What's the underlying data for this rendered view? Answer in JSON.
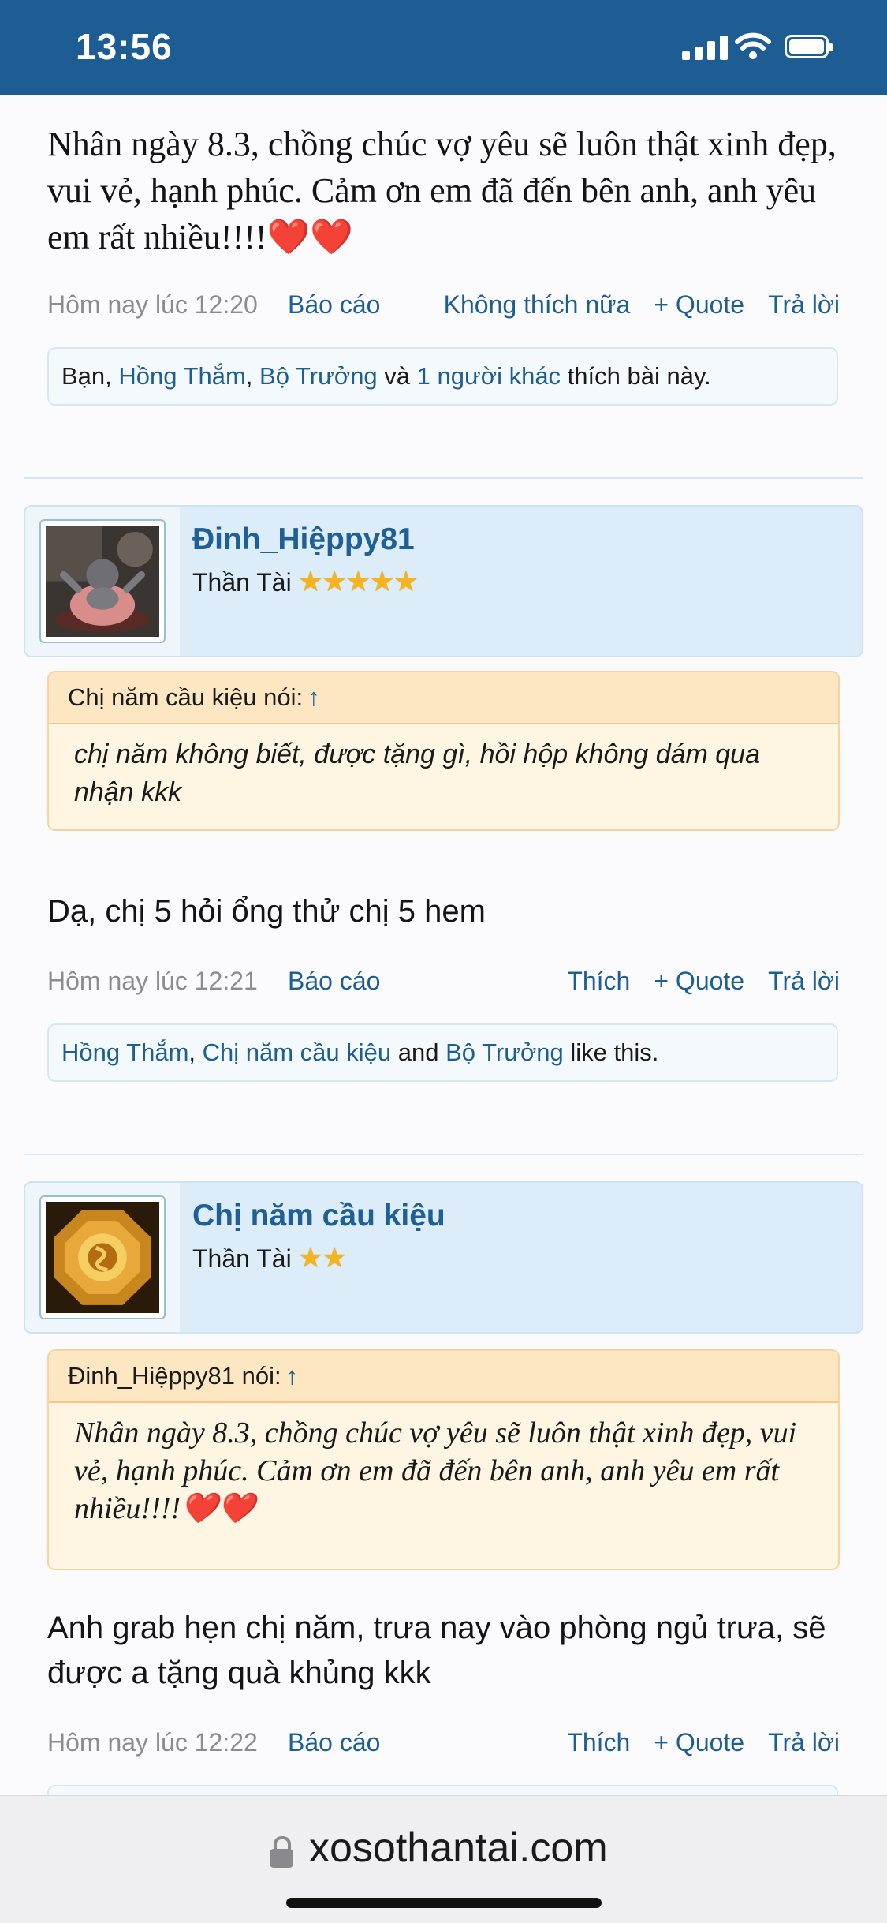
{
  "status_bar": {
    "time": "13:56"
  },
  "posts": [
    {
      "message": "Nhân ngày 8.3, chồng chúc vợ yêu sẽ luôn thật xinh đẹp, vui vẻ, hạnh phúc. Cảm ơn em đã đến bên anh, anh yêu em rất nhiều!!!!❤️❤️",
      "date": "Hôm nay lúc 12:20",
      "report": "Báo cáo",
      "like_action": "Không thích nữa",
      "quote_action": "+ Quote",
      "reply_action": "Trả lời",
      "likes": {
        "prefix": "Bạn, ",
        "user1": "Hồng Thắm",
        "sep1": ", ",
        "user2": "Bộ Trưởng",
        "sep2": " và ",
        "others": "1 người khác",
        "suffix": " thích bài này."
      }
    },
    {
      "user": {
        "name": "Đinh_Hiệppy81",
        "rank": "Thần Tài",
        "stars": "★★★★★",
        "avatar": "laughing-buddha-statue"
      },
      "quote": {
        "author": "Chị năm cầu kiệu nói:",
        "arrow": "↑",
        "text": "chị năm không biết, được tặng gì, hồi hộp không dám qua nhận kkk"
      },
      "message": "Dạ, chị 5 hỏi ổng thử chị 5 hem",
      "date": "Hôm nay lúc 12:21",
      "report": "Báo cáo",
      "like_action": "Thích",
      "quote_action": "+ Quote",
      "reply_action": "Trả lời",
      "likes": {
        "user1": "Hồng Thắm",
        "sep1": ", ",
        "user2": "Chị năm cầu kiệu",
        "sep2": " and ",
        "user3": "Bộ Trưởng",
        "suffix": " like this."
      }
    },
    {
      "user": {
        "name": "Chị năm cầu kiệu",
        "rank": "Thần Tài",
        "stars": "★★",
        "avatar": "golden-bagua-charm"
      },
      "quote": {
        "author": "Đinh_Hiệppy81 nói:",
        "arrow": "↑",
        "text": "Nhân ngày 8.3, chồng chúc vợ yêu sẽ luôn thật xinh đẹp, vui vẻ, hạnh phúc. Cảm ơn em đã đến bên anh, anh yêu em rất nhiều!!!!❤️❤️"
      },
      "message": "Anh grab hẹn chị năm, trưa nay vào phòng ngủ trưa, sẽ được a tặng quà khủng kkk",
      "date": "Hôm nay lúc 12:22",
      "report": "Báo cáo",
      "like_action": "Thích",
      "quote_action": "+ Quote",
      "reply_action": "Trả lời"
    }
  ],
  "browser": {
    "url": "xosothantai.com"
  },
  "colors": {
    "status_bar": "#1e5d93",
    "link": "#1d5f93",
    "quote_bg": "#fff5e3",
    "user_card_bg": "#dcecf9"
  }
}
